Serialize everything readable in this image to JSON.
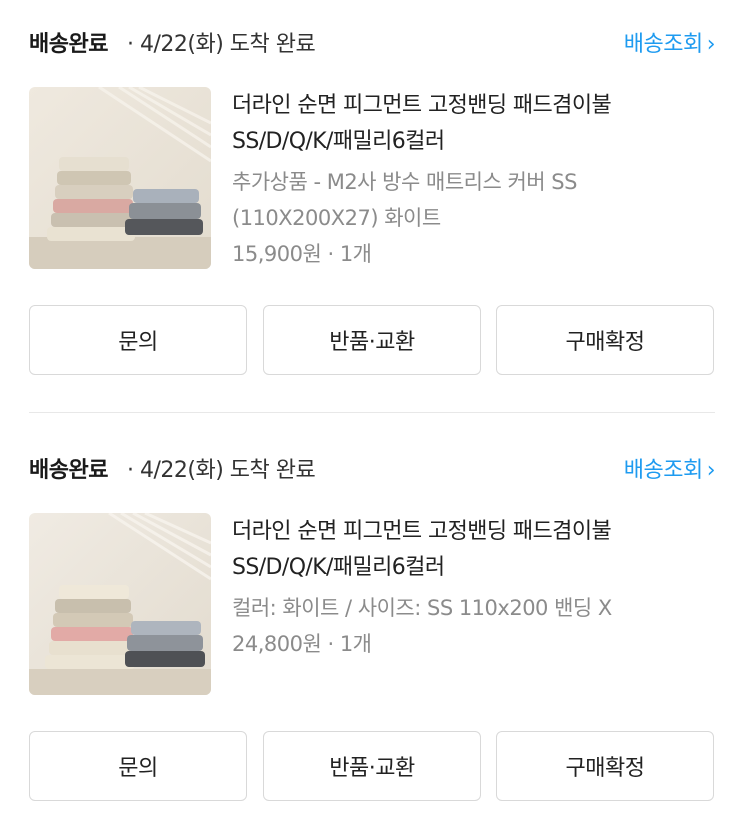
{
  "orders": [
    {
      "status": "배송완료",
      "date_text": "· 4/22(화) 도착 완료",
      "track_label": "배송조회",
      "product_name": "더라인 순면 피그먼트 고정밴딩 패드겸이불 SS/D/Q/K/패밀리6컬러",
      "option_text": "추가상품 - M2사 방수 매트리스 커버 SS (110X200X27) 화이트",
      "price_text": "15,900원 · 1개",
      "buttons": [
        "문의",
        "반품·교환",
        "구매확정"
      ],
      "image_icon": "folded-bedding-photo"
    },
    {
      "status": "배송완료",
      "date_text": "· 4/22(화) 도착 완료",
      "track_label": "배송조회",
      "product_name": "더라인 순면 피그먼트 고정밴딩 패드겸이불 SS/D/Q/K/패밀리6컬러",
      "option_text": "컬러: 화이트 / 사이즈: SS 110x200 밴딩 X",
      "price_text": "24,800원 · 1개",
      "buttons": [
        "문의",
        "반품·교환",
        "구매확정"
      ],
      "image_icon": "folded-bedding-photo"
    }
  ],
  "colors": {
    "accent": "#1e9bf0",
    "text": "#222222",
    "muted": "#8b8b8b",
    "border": "#d9d9d9"
  }
}
